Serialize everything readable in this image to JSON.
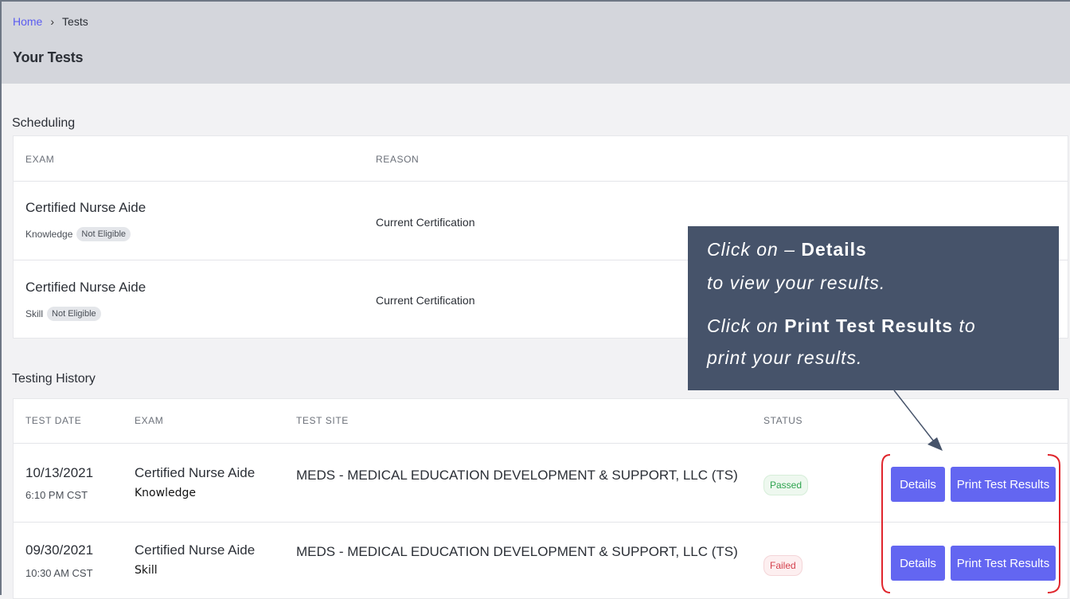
{
  "breadcrumb": {
    "home": "Home",
    "separator": "›",
    "current": "Tests"
  },
  "page_title": "Your Tests",
  "scheduling": {
    "title": "Scheduling",
    "columns": [
      "EXAM",
      "REASON"
    ],
    "rows": [
      {
        "exam": "Certified Nurse Aide",
        "type": "Knowledge",
        "eligibility": "Not Eligible",
        "reason": "Current Certification"
      },
      {
        "exam": "Certified Nurse Aide",
        "type": "Skill",
        "eligibility": "Not Eligible",
        "reason": "Current Certification"
      }
    ]
  },
  "history": {
    "title": "Testing History",
    "columns": [
      "TEST DATE",
      "EXAM",
      "TEST SITE",
      "STATUS"
    ],
    "rows": [
      {
        "date": "10/13/2021",
        "time": "6:10 PM CST",
        "exam": "Certified Nurse Aide",
        "type": "Knowledge",
        "site": "MEDS - MEDICAL EDUCATION DEVELOPMENT & SUPPORT, LLC (TS)",
        "status": "Passed",
        "details_label": "Details",
        "print_label": "Print Test Results"
      },
      {
        "date": "09/30/2021",
        "time": "10:30 AM CST",
        "exam": "Certified Nurse Aide",
        "type": "Skill",
        "site": "MEDS - MEDICAL EDUCATION DEVELOPMENT & SUPPORT, LLC (TS)",
        "status": "Failed",
        "details_label": "Details",
        "print_label": "Print Test Results"
      }
    ]
  },
  "callout": {
    "line1_prefix": "Click on –",
    "line1_bold": "Details",
    "line2": "to view your results.",
    "line3_prefix": "Click on",
    "line3_bold": "Print Test Results",
    "line3_suffix": "to",
    "line4": "print your results."
  },
  "colors": {
    "accent": "#6366f1",
    "header_bg": "#d4d6dc",
    "callout_bg": "#46536a",
    "annotation_red": "#e0262d",
    "passed": "#2ea44f",
    "failed": "#d4414d"
  }
}
